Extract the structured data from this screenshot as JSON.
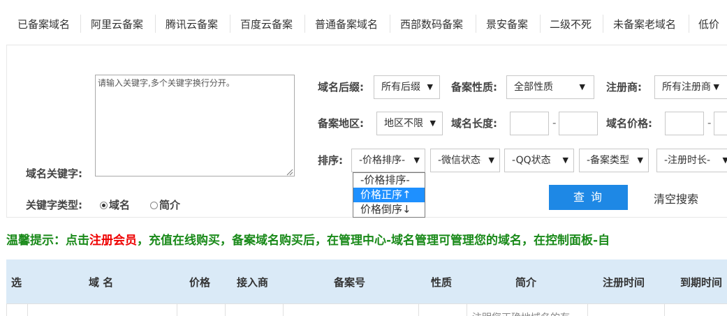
{
  "nav": {
    "tabs": [
      "已备案域名",
      "阿里云备案",
      "腾讯云备案",
      "百度云备案",
      "普通备案域名",
      "西部数码备案",
      "景安备案",
      "二级不死",
      "未备案老域名",
      "低价"
    ]
  },
  "search": {
    "keyword_label": "域名关键字:",
    "keyword_placeholder": "请输入关键字,多个关键字换行分开。",
    "suffix_label": "域名后缀:",
    "suffix_value": "所有后缀",
    "nature_label": "备案性质:",
    "nature_value": "全部性质",
    "registrar_label": "注册商:",
    "registrar_value": "所有注册商",
    "region_label": "备案地区:",
    "region_value": "地区不限",
    "length_label": "域名长度:",
    "price_label": "域名价格:",
    "sort_label": "排序:",
    "sort_value": "-价格排序-",
    "wechat_value": "-微信状态-",
    "qq_value": "-QQ状态",
    "type_value": "-备案类型-",
    "regtime_value": "-注册时长-",
    "sort_options": [
      "-价格排序-",
      "价格正序↑",
      "价格倒序↓"
    ],
    "kwtype_label": "关键字类型:",
    "kwtype_domain": "域名",
    "kwtype_intro": "简介",
    "query_button": "查 询",
    "clear_button": "清空搜索"
  },
  "notice": {
    "prefix": "温馨提示：点击",
    "link": "注册会员",
    "suffix": "，充值在线购买，备案域名购买后，在管理中心-域名管理可管理您的域名，在控制面板-自"
  },
  "table": {
    "headers": [
      "选",
      "域 名",
      "价格",
      "接入商",
      "备案号",
      "性质",
      "简介",
      "注册时间",
      "到期时间"
    ],
    "partial_text": "注明您正确地域名的有"
  }
}
